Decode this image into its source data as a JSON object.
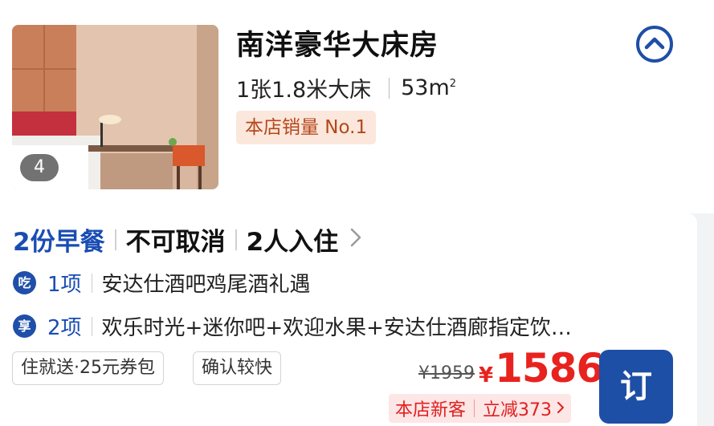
{
  "room": {
    "title": "南洋豪华大床房",
    "bed": "1张1.8米大床",
    "area": "53㎡",
    "area_number": "53m",
    "area_sup": "2",
    "sales_badge": "本店销量 No.1",
    "photo_count": "4"
  },
  "rate": {
    "breakfast": "2份早餐",
    "cancellation": "不可取消",
    "occupancy": "2人入住",
    "perks": [
      {
        "icon_label": "吃",
        "icon": "dining-icon",
        "count": "1项",
        "text": "安达仕酒吧鸡尾酒礼遇"
      },
      {
        "icon_label": "享",
        "icon": "enjoy-icon",
        "count": "2项",
        "text": "欢乐时光+迷你吧+欢迎水果+安达仕酒廊指定饮…"
      }
    ],
    "tags": [
      "住就送·25元券包",
      "确认较快"
    ],
    "original_price": "¥1959",
    "currency": "¥",
    "price": "1586",
    "promo_label": "本店新客",
    "promo_discount": "立减373",
    "book_label": "订"
  },
  "colors": {
    "brand_blue": "#1e4fa6",
    "price_red": "#e8221e",
    "badge_bg": "#fbe7dc",
    "badge_text": "#b5471b"
  }
}
